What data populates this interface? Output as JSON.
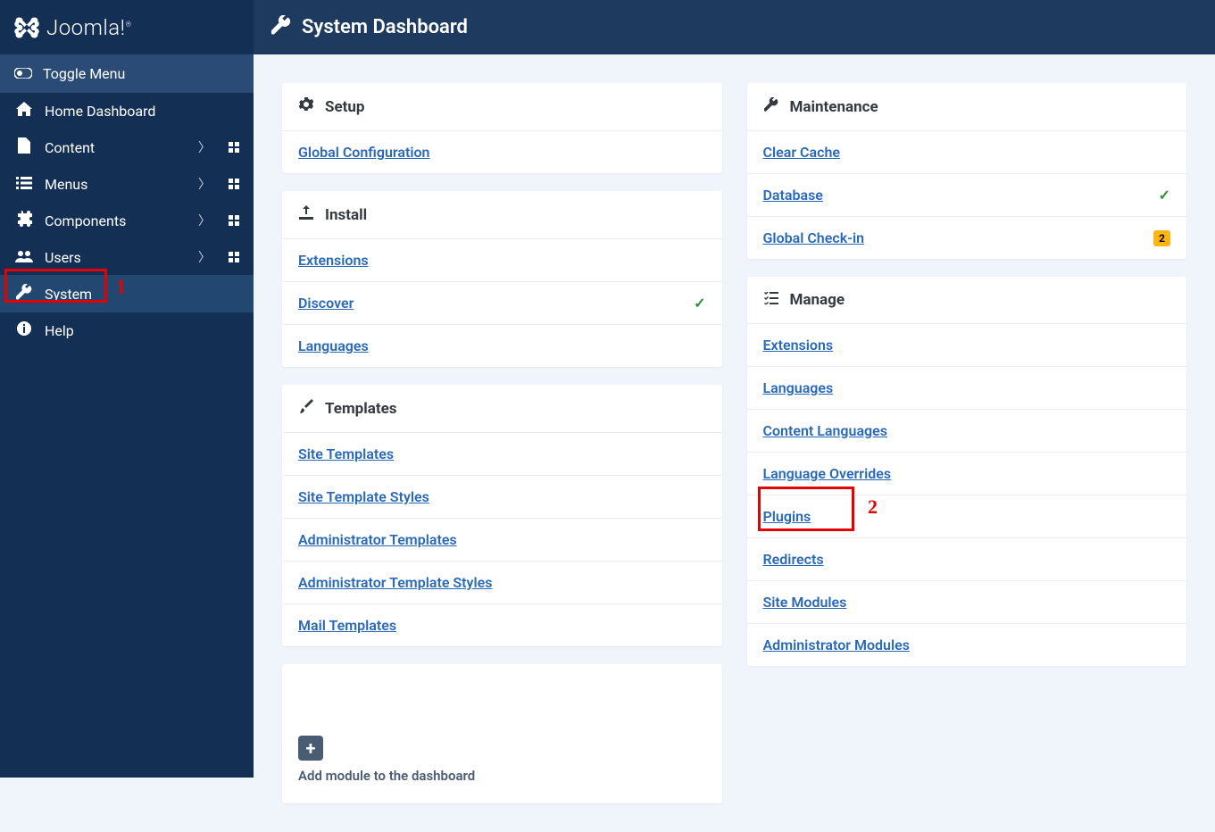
{
  "brand": {
    "name": "Joomla!"
  },
  "header": {
    "title": "System Dashboard"
  },
  "sidebar": {
    "toggle": "Toggle Menu",
    "items": [
      {
        "label": "Home Dashboard",
        "icon": "home",
        "has_sub": false,
        "has_grid": false
      },
      {
        "label": "Content",
        "icon": "file",
        "has_sub": true,
        "has_grid": true
      },
      {
        "label": "Menus",
        "icon": "list",
        "has_sub": true,
        "has_grid": true
      },
      {
        "label": "Components",
        "icon": "puzzle",
        "has_sub": true,
        "has_grid": true
      },
      {
        "label": "Users",
        "icon": "users",
        "has_sub": true,
        "has_grid": true
      },
      {
        "label": "System",
        "icon": "wrench",
        "has_sub": false,
        "has_grid": false,
        "active": true
      },
      {
        "label": "Help",
        "icon": "info",
        "has_sub": false,
        "has_grid": false
      }
    ]
  },
  "panels": {
    "left": [
      {
        "title": "Setup",
        "icon": "gear",
        "links": [
          {
            "label": "Global Configuration"
          }
        ]
      },
      {
        "title": "Install",
        "icon": "upload",
        "links": [
          {
            "label": "Extensions"
          },
          {
            "label": "Discover",
            "check": true
          },
          {
            "label": "Languages"
          }
        ]
      },
      {
        "title": "Templates",
        "icon": "brush",
        "links": [
          {
            "label": "Site Templates"
          },
          {
            "label": "Site Template Styles"
          },
          {
            "label": "Administrator Templates"
          },
          {
            "label": "Administrator Template Styles"
          },
          {
            "label": "Mail Templates"
          }
        ]
      }
    ],
    "right": [
      {
        "title": "Maintenance",
        "icon": "wrench",
        "links": [
          {
            "label": "Clear Cache"
          },
          {
            "label": "Database",
            "check": true
          },
          {
            "label": "Global Check-in",
            "badge": "2"
          }
        ]
      },
      {
        "title": "Manage",
        "icon": "list-check",
        "links": [
          {
            "label": "Extensions"
          },
          {
            "label": "Languages"
          },
          {
            "label": "Content Languages"
          },
          {
            "label": "Language Overrides"
          },
          {
            "label": "Plugins"
          },
          {
            "label": "Redirects"
          },
          {
            "label": "Site Modules"
          },
          {
            "label": "Administrator Modules"
          }
        ]
      }
    ]
  },
  "add_module": {
    "label": "Add module to the dashboard"
  },
  "annotations": {
    "one": "1",
    "two": "2"
  }
}
